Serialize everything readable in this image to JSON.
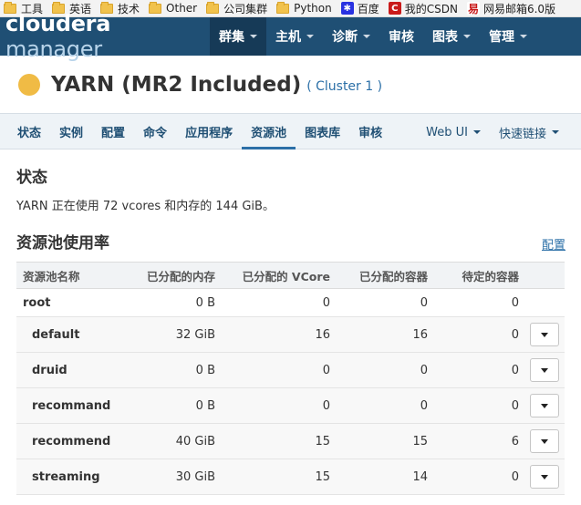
{
  "bookmarks": [
    {
      "label": "工具",
      "icon": "folder-icon"
    },
    {
      "label": "英语",
      "icon": "folder-icon"
    },
    {
      "label": "技术",
      "icon": "folder-icon"
    },
    {
      "label": "Other",
      "icon": "folder-icon"
    },
    {
      "label": "公司集群",
      "icon": "folder-icon"
    },
    {
      "label": "Python",
      "icon": "folder-icon"
    },
    {
      "label": "百度",
      "icon": "baidu-icon"
    },
    {
      "label": "我的CSDN",
      "icon": "csdn-icon"
    },
    {
      "label": "网易邮箱6.0版",
      "icon": "netease-icon"
    }
  ],
  "logo": {
    "part1": "cloudera",
    "part2": "manager"
  },
  "topnav": {
    "items": [
      {
        "label": "群集"
      },
      {
        "label": "主机"
      },
      {
        "label": "诊断"
      },
      {
        "label": "审核"
      },
      {
        "label": "图表"
      },
      {
        "label": "管理"
      }
    ]
  },
  "service": {
    "title": "YARN (MR2 Included)",
    "cluster": "( Cluster 1 )",
    "status_color": "#f0bb45"
  },
  "subnav": {
    "items": [
      {
        "label": "状态"
      },
      {
        "label": "实例"
      },
      {
        "label": "配置"
      },
      {
        "label": "命令"
      },
      {
        "label": "应用程序"
      },
      {
        "label": "资源池"
      },
      {
        "label": "图表库"
      },
      {
        "label": "审核"
      }
    ],
    "webui": "Web UI",
    "quicklinks": "快速链接"
  },
  "status_section": {
    "heading": "状态",
    "text": "YARN 正在使用 72 vcores 和内存的 144 GiB。"
  },
  "pool_section": {
    "heading": "资源池使用率",
    "config_link": "配置",
    "columns": [
      "资源池名称",
      "已分配的内存",
      "已分配的 VCore",
      "已分配的容器",
      "待定的容器"
    ],
    "root": {
      "name": "root",
      "memory": "0 B",
      "vcore": "0",
      "containers": "0",
      "pending": "0"
    },
    "rows": [
      {
        "name": "default",
        "memory": "32 GiB",
        "vcore": "16",
        "containers": "16",
        "pending": "0"
      },
      {
        "name": "druid",
        "memory": "0 B",
        "vcore": "0",
        "containers": "0",
        "pending": "0"
      },
      {
        "name": "recommand",
        "memory": "0 B",
        "vcore": "0",
        "containers": "0",
        "pending": "0"
      },
      {
        "name": "recommend",
        "memory": "40 GiB",
        "vcore": "15",
        "containers": "15",
        "pending": "6"
      },
      {
        "name": "streaming",
        "memory": "30 GiB",
        "vcore": "15",
        "containers": "14",
        "pending": "0"
      }
    ]
  },
  "colors": {
    "topnav_bg": "#1f4f74",
    "accent_link": "#2b6fa7",
    "subnav_bg": "#eef3f7"
  }
}
